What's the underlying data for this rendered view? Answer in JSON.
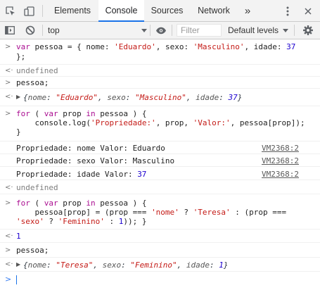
{
  "devtools": {
    "tabs": [
      {
        "label": "Elements"
      },
      {
        "label": "Console"
      },
      {
        "label": "Sources"
      },
      {
        "label": "Network"
      }
    ],
    "more_tabs": "»"
  },
  "toolbar": {
    "context": "top",
    "filter_placeholder": "Filter",
    "levels": "Default levels"
  },
  "console": {
    "cmd1_line1": "var pessoa = { nome: 'Eduardo', sexo: 'Masculino', idade: 37",
    "cmd1_line2": "};",
    "result1": "undefined",
    "cmd2": "pessoa;",
    "obj1": "{nome: \"Eduardo\", sexo: \"Masculino\", idade: 37}",
    "cmd3_line1": "for ( var prop in pessoa ) {",
    "cmd3_line2": "    console.log('Propriedade:', prop, 'Valor:', pessoa[prop]);",
    "cmd3_line3": "}",
    "logs": [
      {
        "text": "Propriedade: nome Valor: Eduardo",
        "source": "VM2368:2"
      },
      {
        "text": "Propriedade: sexo Valor: Masculino",
        "source": "VM2368:2"
      },
      {
        "text": "Propriedade: idade Valor: 37",
        "source": "VM2368:2"
      }
    ],
    "result3": "undefined",
    "cmd4_line1": "for ( var prop in pessoa ) {",
    "cmd4_line2": "    pessoa[prop] = (prop === 'nome' ? 'Teresa' : (prop ===",
    "cmd4_line3": "'sexo' ? 'Feminino' : 1)); }",
    "result4": "1",
    "cmd5": "pessoa;",
    "obj2": "{nome: \"Teresa\", sexo: \"Feminino\", idade: 1}"
  },
  "colors": {
    "string": "#c41a16",
    "number": "#1c00cf",
    "keyword": "#aa0d91",
    "active_tab": "#1a73e8"
  }
}
